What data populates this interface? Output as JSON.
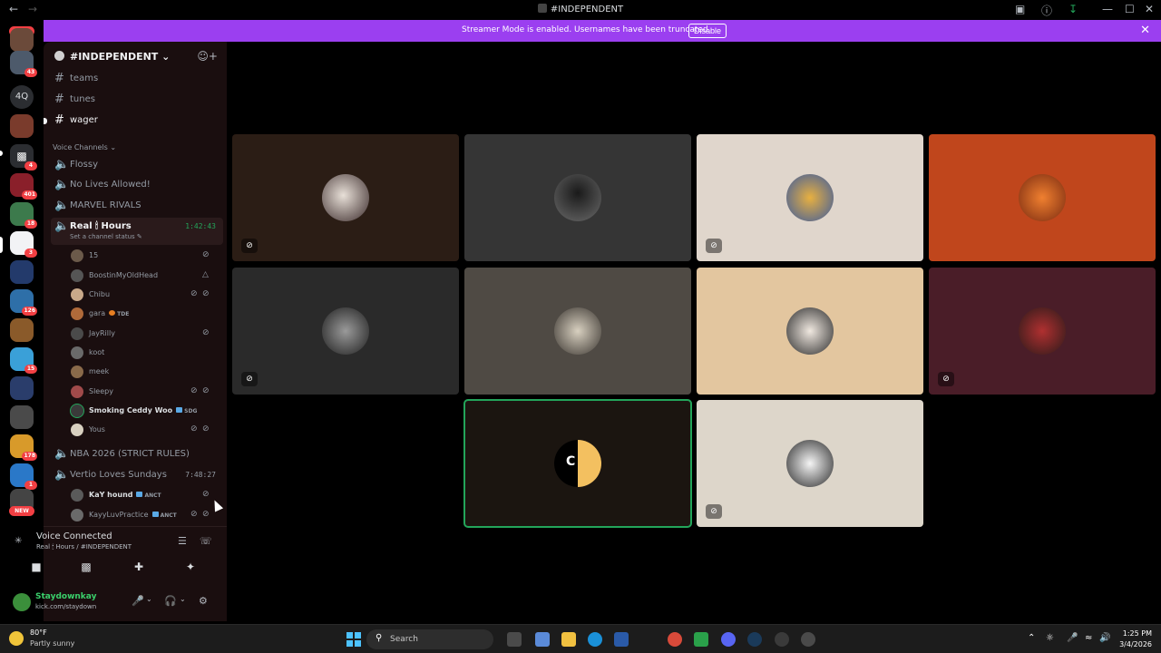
{
  "titlebar": {
    "title": "#INDEPENDENT",
    "back_icon": "arrow-left-icon",
    "forward_icon": "arrow-right-icon"
  },
  "rail": {
    "new_top": "NEW",
    "new_bottom": "NEW",
    "server_4q": "4Q",
    "badges": [
      "43",
      "4",
      "401",
      "18",
      "3",
      "126",
      "15",
      "178",
      "1"
    ]
  },
  "guild": {
    "name": "#INDEPENDENT",
    "text_channels": [
      "teams",
      "tunes",
      "wager"
    ],
    "voice_category": "Voice Channels",
    "voice_channels": {
      "flossy": "Flossy",
      "no_lives": "No Lives Allowed!",
      "marvel": "MARVEL RIVALS",
      "real_hours": "Real 🕯 Hours",
      "real_hours_timer": "1:42:43",
      "real_hours_status": "Set a channel status",
      "nba": "NBA 2026 (STRICT RULES)",
      "vertio": "Vertio Loves Sundays",
      "vertio_timer": "7:48:27"
    },
    "real_hours_users": [
      "15",
      "BoostinMyOldHead",
      "Chibu",
      "gara",
      "JayRilly",
      "koot",
      "meek",
      "Sleepy",
      "Smoking Ceddy Woo",
      "Yous"
    ],
    "gara_tag": "TDE",
    "ceddy_tag": "SDG",
    "vertio_users": [
      "KaY hound",
      "KayyLuvPractice"
    ],
    "vertio_tag": "ANCT"
  },
  "voice_panel": {
    "title": "Voice Connected",
    "subtitle": "Real 🕯 Hours / #INDEPENDENT"
  },
  "user_panel": {
    "name": "Staydownkay",
    "status": "kick.com/staydown"
  },
  "banner": {
    "message": "Streamer Mode is enabled. Usernames have been truncated.",
    "disable_label": "Disable"
  },
  "tiles": {
    "colors": [
      "#2b1d15",
      "#353535",
      "#e0d6cc",
      "#c0461c",
      "#2a2a2a",
      "#4f4a44",
      "#e3c69f",
      "#4a1d28",
      "#1b1510",
      "#ddd6ca"
    ]
  },
  "taskbar": {
    "temp": "80°F",
    "condition": "Partly sunny",
    "search_placeholder": "Search",
    "time": "1:25 PM",
    "date": "3/4/2026"
  }
}
